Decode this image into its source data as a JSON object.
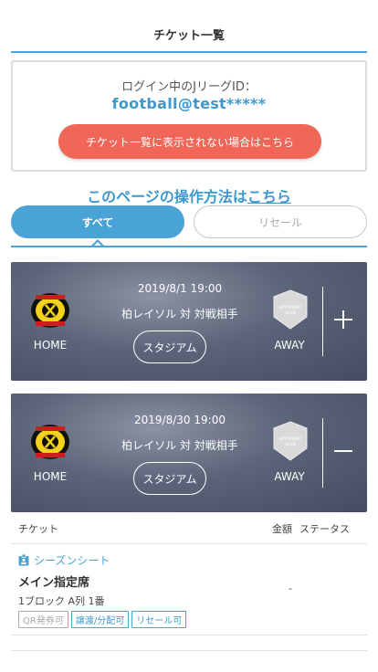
{
  "header": {
    "title": "チケット一覧"
  },
  "login": {
    "label": "ログイン中のJリーグID：",
    "id": "football@test*****",
    "help_button": "チケット一覧に表示されない場合はこちら"
  },
  "howto": {
    "prefix": "このページの操作方法は",
    "link": "こちら"
  },
  "tabs": [
    {
      "label": "すべて",
      "active": true
    },
    {
      "label": "リセール",
      "active": false
    }
  ],
  "matches": [
    {
      "date": "2019/8/1 19:00",
      "teams": "柏レイソル 対 対戦相手",
      "stadium_button": "スタジアム",
      "home_label": "HOME",
      "away_label": "AWAY",
      "away_logo_text": "OPPONENT TEAM",
      "toggle_icon": "plus-icon",
      "expanded": false
    },
    {
      "date": "2019/8/30 19:00",
      "teams": "柏レイソル 対 対戦相手",
      "stadium_button": "スタジアム",
      "home_label": "HOME",
      "away_label": "AWAY",
      "away_logo_text": "OPPONENT TEAM",
      "toggle_icon": "minus-icon",
      "expanded": true
    }
  ],
  "ticket_list": {
    "columns": {
      "ticket": "チケット",
      "price": "金額",
      "status": "ステータス"
    },
    "rows": [
      {
        "type": "シーズンシート",
        "seat": "メイン指定席",
        "detail": "1ブロック A列 1番",
        "price": "-",
        "tags": [
          {
            "label": "QR発券可",
            "enabled": false
          },
          {
            "label": "譲渡/分配可",
            "enabled": true
          },
          {
            "label": "リセール可",
            "enabled": true
          }
        ]
      }
    ]
  },
  "colors": {
    "accent": "#4aa3d6",
    "help_button": "#f0675a",
    "match_card": "#5c6479"
  }
}
